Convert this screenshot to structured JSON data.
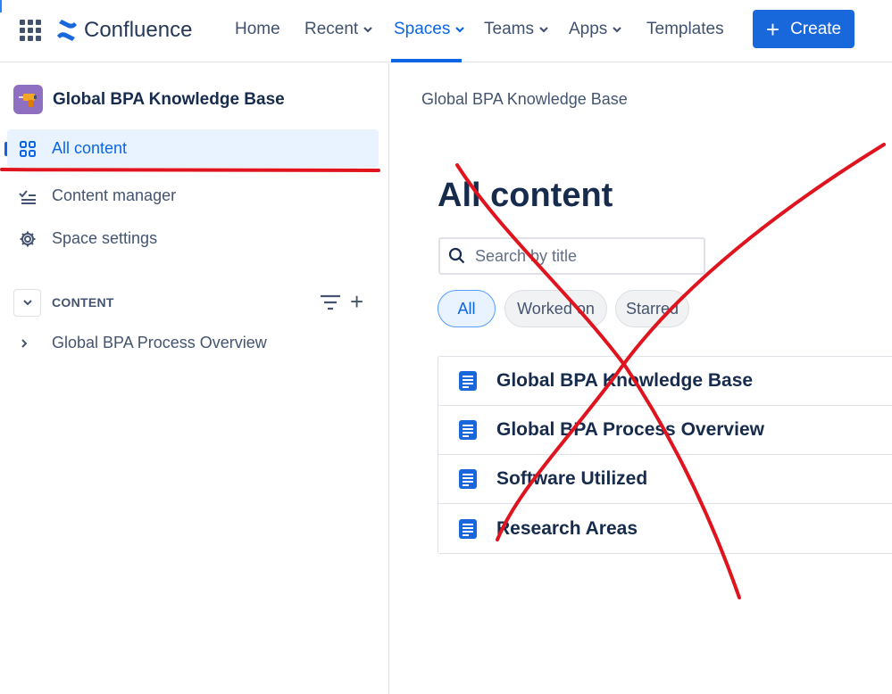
{
  "topnav": {
    "logo_text": "Confluence",
    "items": [
      {
        "label": "Home",
        "has_chevron": false
      },
      {
        "label": "Recent",
        "has_chevron": true
      },
      {
        "label": "Spaces",
        "has_chevron": true,
        "active": true
      },
      {
        "label": "Teams",
        "has_chevron": true
      },
      {
        "label": "Apps",
        "has_chevron": true
      },
      {
        "label": "Templates",
        "has_chevron": false
      }
    ],
    "create_label": "Create",
    "accent_color": "#0c66e4",
    "create_color": "#1868db"
  },
  "sidebar": {
    "space_name": "Global BPA Knowledge Base",
    "space_avatar_color": "#8f6fc1",
    "items": [
      {
        "label": "All content",
        "icon": "grid-icon",
        "selected": true
      },
      {
        "label": "Content manager",
        "icon": "checklist-icon",
        "selected": false
      },
      {
        "label": "Space settings",
        "icon": "gear-icon",
        "selected": false
      }
    ],
    "content_section_label": "CONTENT",
    "tree": [
      {
        "label": "Global BPA Process Overview"
      }
    ]
  },
  "main": {
    "breadcrumb": "Global BPA Knowledge Base",
    "title": "All content",
    "search": {
      "placeholder": "Search by title",
      "value": ""
    },
    "filters": [
      {
        "label": "All",
        "active": true
      },
      {
        "label": "Worked on",
        "active": false
      },
      {
        "label": "Starred",
        "active": false
      }
    ],
    "pages": [
      {
        "title": "Global BPA Knowledge Base",
        "icon": "document-icon"
      },
      {
        "title": "Global BPA Process Overview",
        "icon": "document-icon"
      },
      {
        "title": "Software Utilized",
        "icon": "document-icon"
      },
      {
        "title": "Research Areas",
        "icon": "document-icon"
      }
    ]
  },
  "annotations": {
    "color": "#e0141e",
    "marks": [
      "underline-under-all-content",
      "large-x-cross-over-content-list"
    ]
  }
}
